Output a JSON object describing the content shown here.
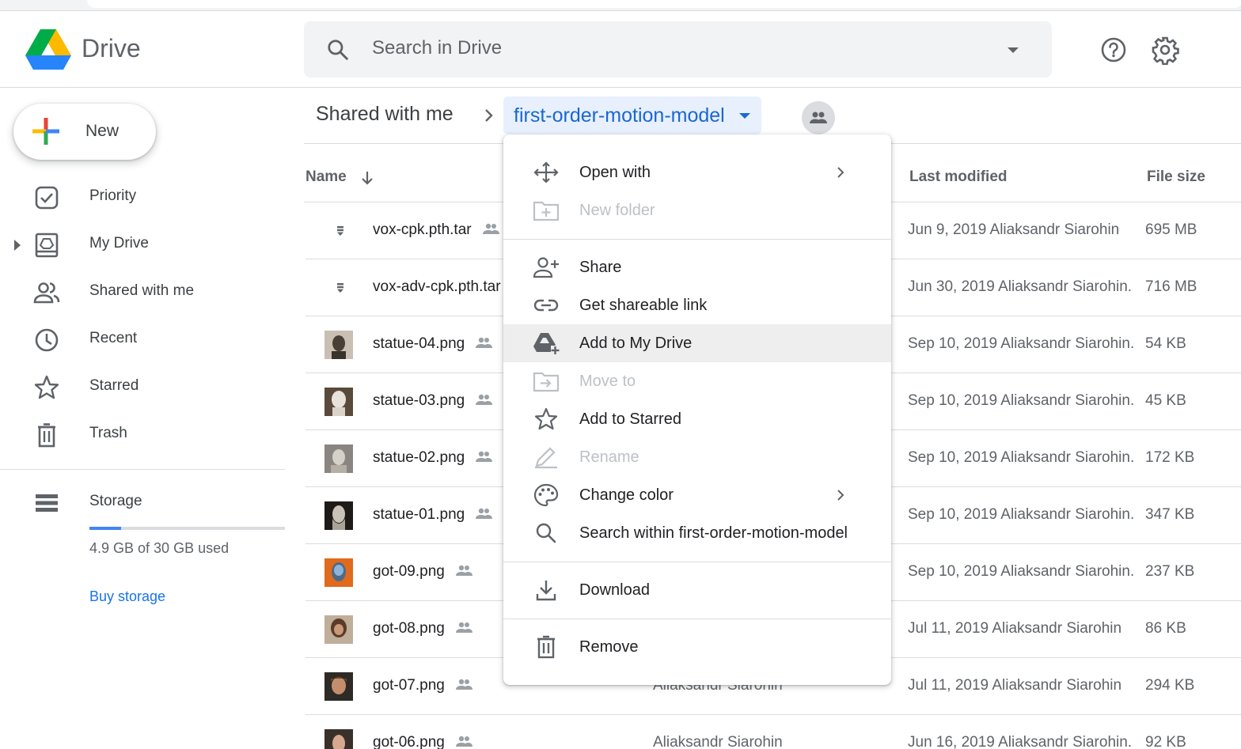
{
  "app": {
    "name": "Drive"
  },
  "search": {
    "placeholder": "Search in Drive"
  },
  "sidebar": {
    "new_label": "New",
    "items": [
      {
        "label": "Priority"
      },
      {
        "label": "My Drive"
      },
      {
        "label": "Shared with me"
      },
      {
        "label": "Recent"
      },
      {
        "label": "Starred"
      },
      {
        "label": "Trash"
      }
    ],
    "storage": {
      "label": "Storage",
      "usage_text": "4.9 GB of 30 GB used",
      "used_fraction": 0.163,
      "buy_label": "Buy storage"
    }
  },
  "breadcrumb": {
    "root": "Shared with me",
    "current": "first-order-motion-model"
  },
  "columns": {
    "name": "Name",
    "last_modified": "Last modified",
    "file_size": "File size"
  },
  "files": [
    {
      "name": "vox-cpk.pth.tar",
      "owner": "",
      "modified": "Jun 9, 2019  Aliaksandr Siarohin",
      "size": "695 MB",
      "icon": "archive-icon"
    },
    {
      "name": "vox-adv-cpk.pth.tar",
      "owner": "",
      "modified": "Jun 30, 2019  Aliaksandr Siarohin.",
      "size": "716 MB",
      "icon": "archive-icon"
    },
    {
      "name": "statue-04.png",
      "owner": "",
      "modified": "Sep 10, 2019  Aliaksandr Siarohin.",
      "size": "54 KB",
      "icon": "image-thumbnail"
    },
    {
      "name": "statue-03.png",
      "owner": "",
      "modified": "Sep 10, 2019  Aliaksandr Siarohin.",
      "size": "45 KB",
      "icon": "image-thumbnail"
    },
    {
      "name": "statue-02.png",
      "owner": "",
      "modified": "Sep 10, 2019  Aliaksandr Siarohin.",
      "size": "172 KB",
      "icon": "image-thumbnail"
    },
    {
      "name": "statue-01.png",
      "owner": "",
      "modified": "Sep 10, 2019  Aliaksandr Siarohin.",
      "size": "347 KB",
      "icon": "image-thumbnail"
    },
    {
      "name": "got-09.png",
      "owner": "",
      "modified": "Sep 10, 2019  Aliaksandr Siarohin.",
      "size": "237 KB",
      "icon": "image-thumbnail"
    },
    {
      "name": "got-08.png",
      "owner": "",
      "modified": "Jul 11, 2019  Aliaksandr Siarohin",
      "size": "86 KB",
      "icon": "image-thumbnail"
    },
    {
      "name": "got-07.png",
      "owner": "Aliaksandr Siarohin",
      "modified": "Jul 11, 2019  Aliaksandr Siarohin",
      "size": "294 KB",
      "icon": "image-thumbnail"
    },
    {
      "name": "got-06.png",
      "owner": "Aliaksandr Siarohin",
      "modified": "Jun 16, 2019  Aliaksandr Siarohin.",
      "size": "92 KB",
      "icon": "image-thumbnail"
    }
  ],
  "context_menu": {
    "items": [
      {
        "label": "Open with",
        "icon": "move-arrows-icon",
        "submenu": true
      },
      {
        "label": "New folder",
        "icon": "new-folder-icon",
        "disabled": true
      },
      {
        "label": "Share",
        "icon": "person-add-icon"
      },
      {
        "label": "Get shareable link",
        "icon": "link-icon"
      },
      {
        "label": "Add to My Drive",
        "icon": "drive-add-icon",
        "highlighted": true
      },
      {
        "label": "Move to",
        "icon": "move-folder-icon",
        "disabled": true
      },
      {
        "label": "Add to Starred",
        "icon": "star-icon"
      },
      {
        "label": "Rename",
        "icon": "pencil-icon",
        "disabled": true
      },
      {
        "label": "Change color",
        "icon": "palette-icon",
        "submenu": true
      },
      {
        "label": "Search within first-order-motion-model",
        "icon": "search-icon"
      },
      {
        "label": "Download",
        "icon": "download-icon"
      },
      {
        "label": "Remove",
        "icon": "trash-icon"
      }
    ]
  },
  "colors": {
    "accent_blue": "#1a73e8",
    "breadcrumb_bg": "#e8f0fe",
    "menu_hover_bg": "#eeeeee",
    "disabled_text": "#bdc1c6"
  }
}
